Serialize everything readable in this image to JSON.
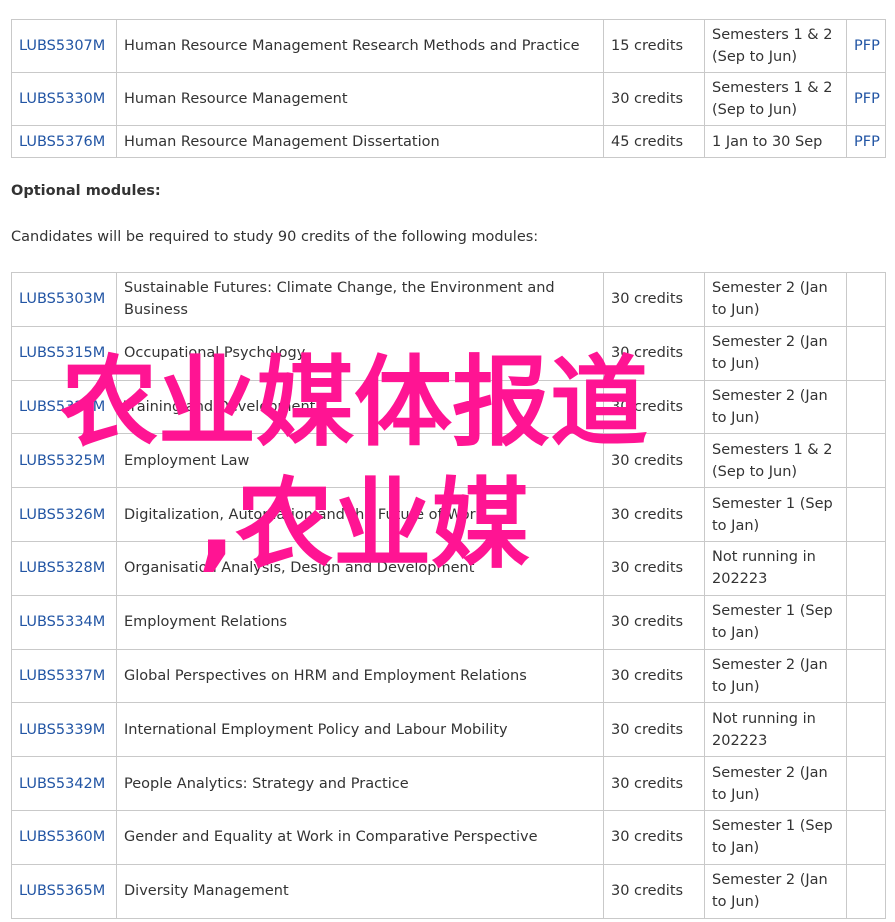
{
  "required_modules": [
    {
      "code": "LUBS5307M",
      "title": "Human Resource Management Research Methods and Practice",
      "credits": "15 credits",
      "semester": "Semesters 1 & 2 (Sep to Jun)",
      "pfp": "PFP"
    },
    {
      "code": "LUBS5330M",
      "title": "Human Resource Management",
      "credits": "30 credits",
      "semester": "Semesters 1 & 2 (Sep to Jun)",
      "pfp": "PFP"
    },
    {
      "code": "LUBS5376M",
      "title": "Human Resource Management Dissertation",
      "credits": "45 credits",
      "semester": "1 Jan to 30 Sep",
      "pfp": "PFP"
    }
  ],
  "optional_section": {
    "heading": "Optional modules:",
    "intro": "Candidates will be required to study 90 credits of the following modules:"
  },
  "optional_modules": [
    {
      "code": "LUBS5303M",
      "title": "Sustainable Futures: Climate Change, the Environment and Business",
      "credits": "30 credits",
      "semester": "Semester 2 (Jan to Jun)"
    },
    {
      "code": "LUBS5315M",
      "title": "Occupational Psychology",
      "credits": "30 credits",
      "semester": "Semester 2 (Jan to Jun)"
    },
    {
      "code": "LUBS5320M",
      "title": "Training and Development",
      "credits": "30 credits",
      "semester": "Semester 2 (Jan to Jun)"
    },
    {
      "code": "LUBS5325M",
      "title": "Employment Law",
      "credits": "30 credits",
      "semester": "Semesters 1 & 2 (Sep to Jun)"
    },
    {
      "code": "LUBS5326M",
      "title": "Digitalization, Automation and the Future of Work",
      "credits": "30 credits",
      "semester": "Semester 1 (Sep to Jan)"
    },
    {
      "code": "LUBS5328M",
      "title": "Organisation Analysis, Design and Development",
      "credits": "30 credits",
      "semester": "Not running in 202223"
    },
    {
      "code": "LUBS5334M",
      "title": "Employment Relations",
      "credits": "30 credits",
      "semester": "Semester 1 (Sep to Jan)"
    },
    {
      "code": "LUBS5337M",
      "title": "Global Perspectives on HRM and Employment Relations",
      "credits": "30 credits",
      "semester": "Semester 2 (Jan to Jun)"
    },
    {
      "code": "LUBS5339M",
      "title": "International Employment Policy and Labour Mobility",
      "credits": "30 credits",
      "semester": "Not running in 202223"
    },
    {
      "code": "LUBS5342M",
      "title": "People Analytics: Strategy and Practice",
      "credits": "30 credits",
      "semester": "Semester 2 (Jan to Jun)"
    },
    {
      "code": "LUBS5360M",
      "title": "Gender and Equality at Work in Comparative Perspective",
      "credits": "30 credits",
      "semester": "Semester 1 (Sep to Jan)"
    },
    {
      "code": "LUBS5365M",
      "title": "Diversity Management",
      "credits": "30 credits",
      "semester": "Semester 2 (Jan to Jun)"
    }
  ],
  "watermark": {
    "line1": "农业媒体报道",
    "line2": ",农业媒",
    "color": "#ff1493"
  }
}
